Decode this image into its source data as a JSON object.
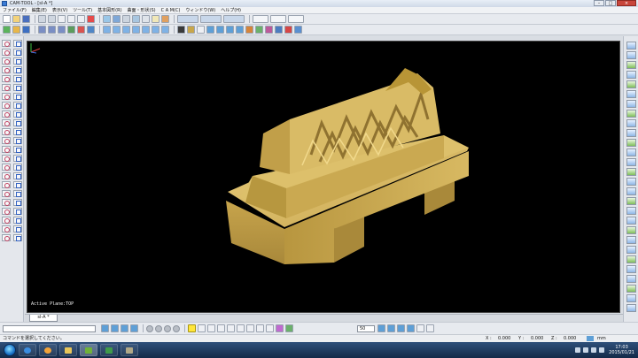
{
  "window": {
    "title": "CAM-TOOL - [sl-A *]"
  },
  "menu": [
    "ファイル(F)",
    "編集(E)",
    "表示(V)",
    "ツール(T)",
    "基本図形(R)",
    "曲面・形状(S)",
    "C A M(C)",
    "ウィンドウ(W)",
    "ヘルプ(H)"
  ],
  "viewport": {
    "active_plane": "Active Plane:TOP"
  },
  "tabs": [
    {
      "label": "sl-A *"
    }
  ],
  "toolbar_bottom": {
    "zoom": "50"
  },
  "status": {
    "message": "コマンドを選択してください。",
    "x_label": "X :",
    "x_value": "0.000",
    "y_label": "Y :",
    "y_value": "0.000",
    "z_label": "Z :",
    "z_value": "0.000",
    "unit": "mm"
  },
  "taskbar": {
    "time": "17:03",
    "date": "2015/01/21"
  },
  "colors": {
    "model": "#c9a851",
    "viewport_bg": "#000000",
    "taskbar": "#1f3a60"
  }
}
